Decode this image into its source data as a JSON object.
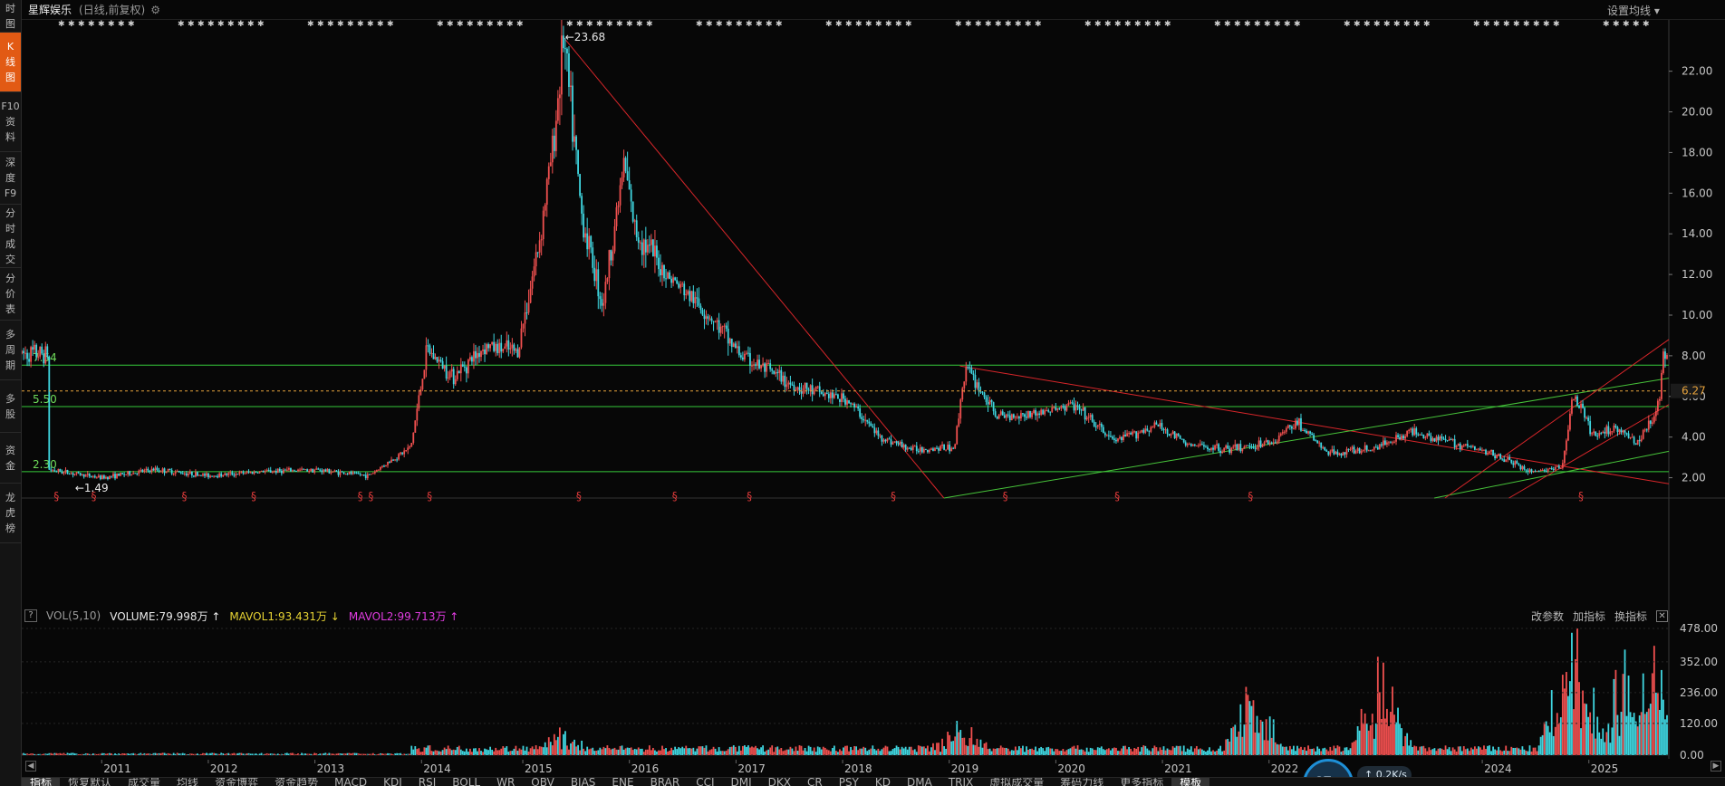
{
  "sidebar": {
    "tabs": [
      {
        "chars": [
          "时",
          "图"
        ],
        "active": false,
        "height": 36
      },
      {
        "chars": [
          "K",
          "线",
          "图"
        ],
        "active": true,
        "height": 66
      },
      {
        "chars": [
          "F10",
          "资",
          "料"
        ],
        "active": false,
        "height": 66
      },
      {
        "chars": [
          "深",
          "度",
          "F9"
        ],
        "active": false,
        "height": 58
      },
      {
        "chars": [
          "分",
          "时",
          "成",
          "交"
        ],
        "active": false,
        "height": 70
      },
      {
        "chars": [
          "分",
          "价",
          "表"
        ],
        "active": false,
        "height": 58
      },
      {
        "chars": [
          "多",
          "周",
          "期"
        ],
        "active": false,
        "height": 66
      },
      {
        "chars": [
          "多",
          "股"
        ],
        "active": false,
        "height": 58
      },
      {
        "chars": [
          "资",
          "金"
        ],
        "active": false,
        "height": 56
      },
      {
        "chars": [
          "龙",
          "虎",
          "榜"
        ],
        "active": false,
        "height": 66
      }
    ]
  },
  "header": {
    "stock_name": "星辉娱乐",
    "period": "(日线,前复权)",
    "gear_icon": "gear-icon",
    "ma_settings": "设置均线 ▾"
  },
  "price_axis": {
    "ticks": [
      "22.00",
      "20.00",
      "18.00",
      "16.00",
      "14.00",
      "12.00",
      "10.00",
      "8.00",
      "6.00",
      "4.00",
      "2.00"
    ],
    "current_price": "6.27",
    "current_price_color": "#e6a23c"
  },
  "annotations": {
    "high_label": "←23.68",
    "low_label": "←1.49",
    "levels": [
      {
        "label": "7.54",
        "value": 7.54
      },
      {
        "label": "5.50",
        "value": 5.5
      },
      {
        "label": "2.30",
        "value": 2.3
      }
    ]
  },
  "volume_panel": {
    "help": "?",
    "name": "VOL(5,10)",
    "volume": "VOLUME:79.998万",
    "mavol1": "MAVOL1:93.431万",
    "mavol2": "MAVOL2:99.713万",
    "tools": [
      "改参数",
      "加指标",
      "换指标"
    ],
    "close": "✕",
    "ticks": [
      "478.00",
      "352.00",
      "236.00",
      "120.00",
      "0.00"
    ]
  },
  "x_axis": {
    "years": [
      "2011",
      "2012",
      "2013",
      "2014",
      "2015",
      "2016",
      "2017",
      "2018",
      "2019",
      "2020",
      "2021",
      "2022",
      "2024",
      "2025"
    ]
  },
  "indicator_tabs": [
    "指标",
    "恢复默认",
    "成交量",
    "均线",
    "资金博弈",
    "资金趋势",
    "MACD",
    "KDJ",
    "RSI",
    "BOLL",
    "WR",
    "OBV",
    "BIAS",
    "ENE",
    "BRAR",
    "CCI",
    "DMI",
    "DKX",
    "CR",
    "PSY",
    "KD",
    "DMA",
    "TRIX",
    "虚拟成交量",
    "筹码力线",
    "更多指标",
    "模板"
  ],
  "speed_widget": {
    "percent": "67",
    "speed": "↑ 0.2K/s"
  },
  "chart_data": {
    "type": "candlestick",
    "title": "星辉娱乐",
    "ylim": [
      1.0,
      23.9
    ],
    "x": [
      "2010.5",
      "2011.0",
      "2011.5",
      "2012.0",
      "2012.5",
      "2013.0",
      "2013.5",
      "2013.9",
      "2014.05",
      "2014.3",
      "2014.6",
      "2014.9",
      "2015.1",
      "2015.25",
      "2015.33",
      "2015.5",
      "2015.7",
      "2015.9",
      "2016.0",
      "2016.3",
      "2016.7",
      "2017.0",
      "2017.5",
      "2018.0",
      "2018.3",
      "2018.6",
      "2019.0",
      "2019.1",
      "2019.4",
      "2019.8",
      "2020.1",
      "2020.5",
      "2020.9",
      "2021.2",
      "2021.6",
      "2022.0",
      "2022.2",
      "2022.5",
      "2022.9",
      "2023.3",
      "2023.7",
      "2024.1",
      "2024.4",
      "2024.7",
      "2024.8",
      "2025.0",
      "2025.2",
      "2025.4",
      "2025.6",
      "2025.65"
    ],
    "close": [
      2.4,
      2.0,
      2.4,
      2.1,
      2.3,
      2.4,
      2.1,
      3.5,
      8.3,
      7.0,
      8.5,
      8.2,
      13.5,
      19.0,
      23.68,
      15.0,
      10.5,
      17.5,
      14.2,
      12.0,
      10.0,
      8.0,
      6.5,
      5.8,
      4.0,
      3.4,
      3.5,
      7.5,
      5.0,
      5.2,
      5.6,
      3.8,
      4.6,
      3.6,
      3.4,
      3.8,
      4.8,
      3.2,
      3.4,
      4.3,
      3.7,
      3.1,
      2.3,
      2.5,
      6.1,
      4.0,
      4.5,
      3.7,
      5.5,
      8.1
    ],
    "volume_ylim": [
      0,
      478
    ],
    "volume_spikes": [
      {
        "x": "2015.3",
        "v": 90
      },
      {
        "x": "2019.05",
        "v": 130
      },
      {
        "x": "2021.8",
        "v": 250
      },
      {
        "x": "2023.0",
        "v": 290
      },
      {
        "x": "2024.8",
        "v": 478
      },
      {
        "x": "2025.3",
        "v": 340
      },
      {
        "x": "2025.6",
        "v": 420
      }
    ]
  }
}
